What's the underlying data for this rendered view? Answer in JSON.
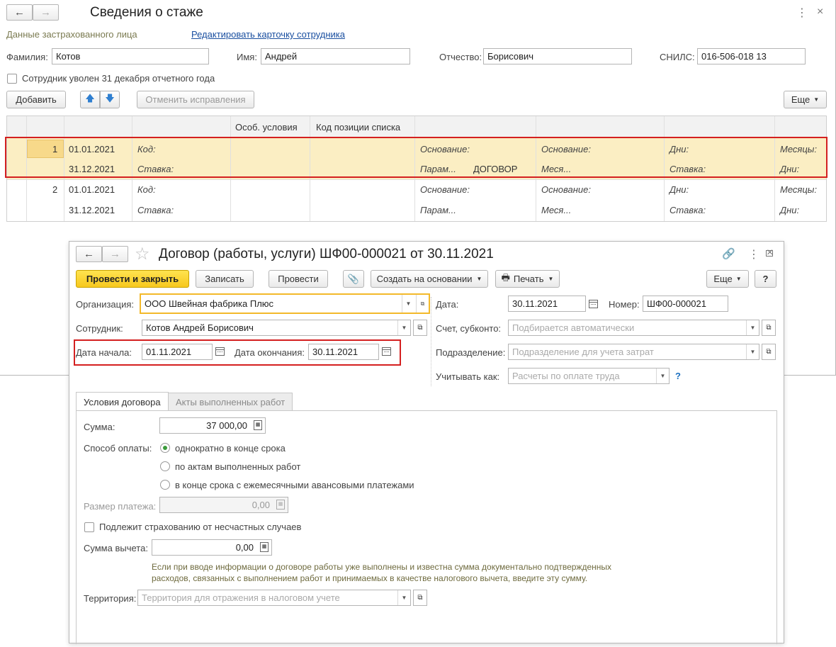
{
  "back_window": {
    "title": "Сведения о стаже",
    "section_label": "Данные застрахованного лица",
    "edit_link": "Редактировать карточку сотрудника",
    "surname": {
      "label": "Фамилия:",
      "value": "Котов"
    },
    "name": {
      "label": "Имя:",
      "value": "Андрей"
    },
    "patronymic": {
      "label": "Отчество:",
      "value": "Борисович"
    },
    "snils": {
      "label": "СНИЛС:",
      "value": "016-506-018 13"
    },
    "dismissed_checkbox": "Сотрудник уволен 31 декабря отчетного года",
    "toolbar": {
      "add": "Добавить",
      "cancel_fix": "Отменить исправления",
      "more": "Еще"
    },
    "table": {
      "headers": [
        "Особ. условия",
        "Код позиции списка"
      ],
      "rows": [
        {
          "num": "1",
          "date_from": "01.01.2021",
          "date_to": "31.12.2021",
          "kod": "Код:",
          "stavka": "Ставка:",
          "osnovanie1": "Основание:",
          "param": "Парам...",
          "dogovor": "ДОГОВОР",
          "osnovanie2": "Основание:",
          "mesya": "Меся...",
          "dni": "Дни:",
          "stavka2": "Ставка:",
          "mesyacy": "Месяцы:",
          "dni2": "Дни:"
        },
        {
          "num": "2",
          "date_from": "01.01.2021",
          "date_to": "31.12.2021",
          "kod": "Код:",
          "stavka": "Ставка:",
          "osnovanie1": "Основание:",
          "param": "Парам...",
          "osnovanie2": "Основание:",
          "mesya": "Меся...",
          "dni": "Дни:",
          "stavka2": "Ставка:",
          "mesyacy": "Месяцы:",
          "dni2": "Дни:"
        }
      ]
    }
  },
  "front_window": {
    "title": "Договор (работы, услуги) ШФ00-000021 от 30.11.2021",
    "toolbar": {
      "post_close": "Провести и закрыть",
      "save": "Записать",
      "post": "Провести",
      "create_based": "Создать на основании",
      "print": "Печать",
      "more": "Еще",
      "help": "?"
    },
    "organization": {
      "label": "Организация:",
      "value": "ООО Швейная фабрика Плюс"
    },
    "employee": {
      "label": "Сотрудник:",
      "value": "Котов Андрей Борисович"
    },
    "start_date": {
      "label": "Дата начала:",
      "value": "01.11.2021"
    },
    "end_date": {
      "label": "Дата окончания:",
      "value": "30.11.2021"
    },
    "date": {
      "label": "Дата:",
      "value": "30.11.2021"
    },
    "number": {
      "label": "Номер:",
      "value": "ШФ00-000021"
    },
    "account": {
      "label": "Счет, субконто:",
      "placeholder": "Подбирается автоматически"
    },
    "department": {
      "label": "Подразделение:",
      "placeholder": "Подразделение для учета затрат"
    },
    "account_as": {
      "label": "Учитывать как:",
      "placeholder": "Расчеты по оплате труда",
      "help": "?"
    },
    "tabs": [
      "Условия договора",
      "Акты выполненных работ"
    ],
    "sum": {
      "label": "Сумма:",
      "value": "37 000,00"
    },
    "payment_method": {
      "label": "Способ оплаты:",
      "options": [
        "однократно в конце срока",
        "по актам выполненных работ",
        "в конце срока с ежемесячными авансовыми платежами"
      ],
      "selected_index": 0
    },
    "payment_size": {
      "label": "Размер платежа:",
      "value": "0,00"
    },
    "insurance_checkbox": "Подлежит страхованию от несчастных случаев",
    "deduction": {
      "label": "Сумма вычета:",
      "value": "0,00"
    },
    "hint_lines": [
      "Если при вводе информации о договоре работы уже выполнены и известна сумма документально подтвержденных",
      "расходов, связанных с выполнением работ и принимаемых в качестве налогового вычета, введите эту сумму."
    ],
    "territory": {
      "label": "Территория:",
      "placeholder": "Территория для отражения в налоговом учете"
    }
  },
  "colors": {
    "highlight_row": "#fbeec3",
    "red_frame": "#d42020",
    "primary_button": "#f7c81e",
    "link": "#1a4fa0"
  }
}
